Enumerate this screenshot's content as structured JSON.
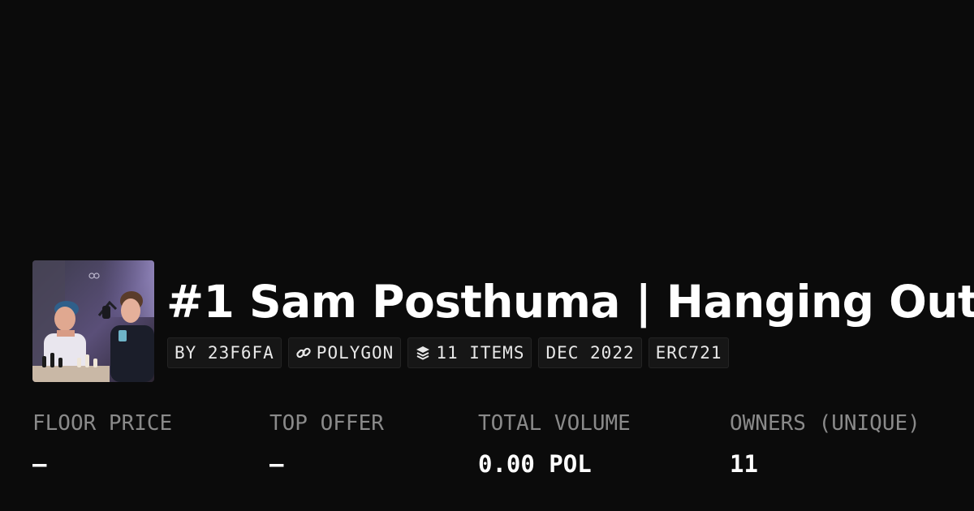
{
  "collection": {
    "title": "#1 Sam Posthuma | Hanging Out",
    "thumbnail_alt": "Two people sitting at a chess board with a podcast microphone"
  },
  "badges": [
    {
      "label": "BY 23F6FA",
      "icon": ""
    },
    {
      "label": "POLYGON",
      "icon": "link-icon"
    },
    {
      "label": "11 ITEMS",
      "icon": "layers-icon"
    },
    {
      "label": "DEC 2022",
      "icon": ""
    },
    {
      "label": "ERC721",
      "icon": ""
    }
  ],
  "stats": [
    {
      "label": "FLOOR PRICE",
      "value": "–"
    },
    {
      "label": "TOP OFFER",
      "value": "–"
    },
    {
      "label": "TOTAL VOLUME",
      "value": "0.00 POL"
    },
    {
      "label": "OWNERS (UNIQUE)",
      "value": "11"
    }
  ],
  "colors": {
    "background": "#0b0b0b",
    "text": "#ffffff",
    "muted": "#8a8a8a",
    "badge_bg": "#161616"
  }
}
